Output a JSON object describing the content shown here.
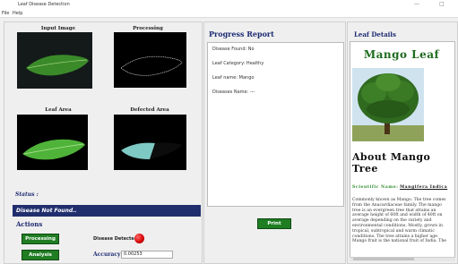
{
  "window": {
    "title": "Leaf Disease Detection",
    "minimize": "—",
    "maximize": "□"
  },
  "menu": {
    "file": "File",
    "help": "Help"
  },
  "images": {
    "input_label": "Input Image",
    "processing_label": "Processing",
    "leaf_area_label": "Leaf Area",
    "defected_area_label": "Defected Area"
  },
  "status": {
    "label": "Status :",
    "value": "Disease Not Found.."
  },
  "actions": {
    "label": "Actions",
    "processing_button": "Processing",
    "analysis_button": "Analysis",
    "disease_detected_label": "Disease Detected",
    "disease_indicator_color": "#d40000",
    "accuracy_label": "Accuracy:",
    "accuracy_value": "0.00253"
  },
  "report": {
    "title": "Progress Report",
    "lines": [
      "Disease Found: No",
      "Leaf Category: Healthy",
      "Leaf name: Mango",
      "Diseases Name: ---"
    ],
    "print_button": "Print"
  },
  "details": {
    "title": "Leaf Details",
    "leaf_name": "Mango Leaf",
    "about_title": "About Mango Tree",
    "scientific_label": "Scientific Name:",
    "scientific_value": "Mangifera Indica",
    "description": "Commonly known as Mango. The tree comes from the Anacardiaceae family. The mango tree is an evergreen tree that attains an average height of 60ft and width of 40ft on average depending on the variety and environmental conditions. Mostly, grown in tropical, subtropical and warm climatic conditions. The tree attains a higher age. Mango fruit is the national fruit of India. The"
  },
  "colors": {
    "accent": "#1c2a72",
    "button_green": "#1f7d22",
    "status_bar": "#202e6e",
    "leaf_title": "#1d6b1d"
  }
}
